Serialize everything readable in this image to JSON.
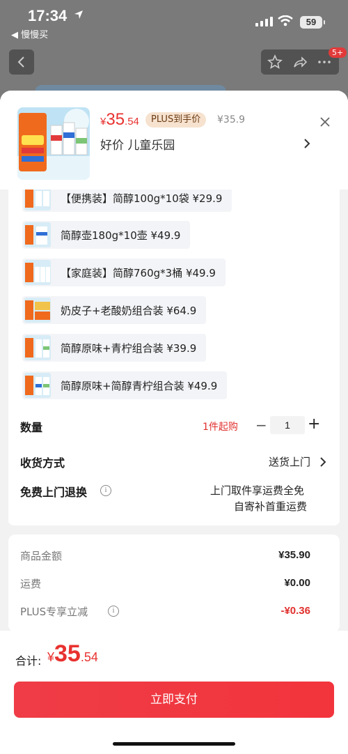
{
  "status_bar": {
    "time": "17:34",
    "back_app": "◀ 慢慢买",
    "battery": "59"
  },
  "background_page": {
    "message_badge": "5+"
  },
  "product": {
    "price_currency": "¥",
    "price_int": "35",
    "price_dec": ".54",
    "plus_tag": "PLUS到手价",
    "original_price": "¥35.9",
    "shop_name": "好价  儿童乐园"
  },
  "variants": [
    {
      "label": "【便携装】简醇100g*10袋  ¥29.9"
    },
    {
      "label": "简醇壶180g*10壶  ¥49.9"
    },
    {
      "label": "【家庭装】简醇760g*3桶  ¥49.9"
    },
    {
      "label": "奶皮子+老酸奶组合装  ¥64.9"
    },
    {
      "label": "简醇原味+青柠组合装  ¥39.9"
    },
    {
      "label": "简醇原味+简醇青柠组合装  ¥49.9"
    }
  ],
  "quantity": {
    "label": "数量",
    "min_order": "1件起购",
    "minus": "−",
    "value": "1",
    "plus": "+"
  },
  "delivery": {
    "label": "收货方式",
    "value": "送货上门"
  },
  "returns": {
    "label": "免费上门退换",
    "line1": "上门取件享运费全免",
    "line2": "自寄补首重运费"
  },
  "costs": {
    "goods_label": "商品金额",
    "goods_value": "¥35.90",
    "shipping_label": "运费",
    "shipping_value": "¥0.00",
    "plus_label": "PLUS专享立减",
    "plus_value": "-¥0.36"
  },
  "footer": {
    "total_label": "合计:",
    "total_currency": "¥",
    "total_int": "35",
    "total_dec": ".54",
    "pay_button": "立即支付"
  },
  "colors": {
    "accent_red": "#e8322f",
    "plus_tag_bg": "#f6e2cf"
  },
  "icons": [
    "location-arrow-icon",
    "signal-icon",
    "wifi-icon",
    "battery-icon",
    "back-arrow-icon",
    "star-icon",
    "share-icon",
    "more-icon",
    "close-icon",
    "chevron-right-icon",
    "info-icon"
  ]
}
